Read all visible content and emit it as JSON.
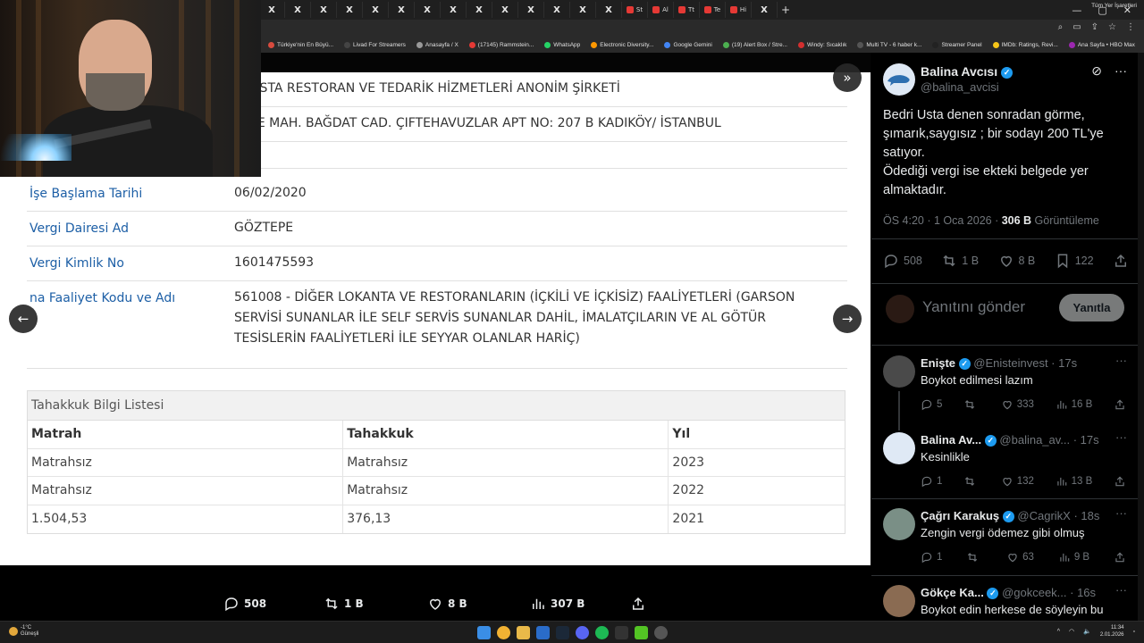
{
  "browser": {
    "tabs": [
      {
        "icon": "x-logo",
        "label": "X"
      },
      {
        "icon": "x-logo",
        "label": "X"
      },
      {
        "icon": "x-logo",
        "label": "X"
      },
      {
        "icon": "x-logo",
        "label": "X"
      },
      {
        "icon": "x-logo",
        "label": "X"
      },
      {
        "icon": "x-logo",
        "label": "X"
      },
      {
        "icon": "x-logo",
        "label": "X"
      },
      {
        "icon": "x-logo",
        "label": "X"
      },
      {
        "icon": "x-logo",
        "label": "X"
      },
      {
        "icon": "x-logo",
        "label": "X"
      },
      {
        "icon": "x-logo",
        "label": "X"
      },
      {
        "icon": "x-logo",
        "label": "X"
      },
      {
        "icon": "x-logo",
        "label": "X"
      },
      {
        "icon": "x-logo",
        "label": "X"
      },
      {
        "icon": "x-logo",
        "label": "X"
      },
      {
        "icon": "x-logo",
        "label": "X"
      },
      {
        "icon": "x-logo",
        "label": "X"
      },
      {
        "icon": "x-logo",
        "label": "X"
      },
      {
        "icon": "x-logo",
        "label": "X"
      },
      {
        "icon": "x-logo",
        "label": "X"
      },
      {
        "icon": "x-logo",
        "label": "X"
      },
      {
        "icon": "x-logo",
        "label": "X"
      },
      {
        "icon": "x-logo",
        "label": "X"
      },
      {
        "icon": "x-logo",
        "label": "X"
      },
      {
        "icon": "red-logo",
        "label": "St"
      },
      {
        "icon": "red-logo",
        "label": "Al"
      },
      {
        "icon": "red-logo",
        "label": "Tt"
      },
      {
        "icon": "red-logo",
        "label": "Te"
      },
      {
        "icon": "red-logo",
        "label": "Hi"
      },
      {
        "icon": "x-logo",
        "label": "X"
      }
    ],
    "new_tab": "+",
    "bookmarks": [
      "Türkiye'nin En Büyü...",
      "Livad For Streamers",
      "Anasayfa / X",
      "(17145) Rammstein...",
      "WhatsApp",
      "Electronic Diversity...",
      "Google Gemini",
      "(19) Alert Box / Stre...",
      "Windy: Sıcaklık",
      "Multi TV - 6 haber k...",
      "Streamer Panel",
      "IMDb: Ratings, Revi...",
      "Ana Sayfa • HBO Max"
    ],
    "bookmarks_all": "Tüm Yer İşaretleri"
  },
  "document": {
    "rows": [
      {
        "label": "",
        "value": "Rİ USTA RESTORAN VE TEDARİK HİZMETLERİ ANONİM ŞİRKETİ"
      },
      {
        "label": "",
        "value": "TEPE MAH. BAĞDAT CAD. ÇIFTEHAVUZLAR APT NO: 207 B KADIKÖY/ İSTANBUL"
      },
      {
        "label": "Faal",
        "value": "Faal"
      },
      {
        "label": "İşe Başlama Tarihi",
        "value": "06/02/2020"
      },
      {
        "label": "Vergi Dairesi Ad",
        "value": "GÖZTEPE"
      },
      {
        "label": "Vergi Kimlik No",
        "value": "1601475593"
      },
      {
        "label": "na Faaliyet Kodu ve Adı",
        "value": "561008 - DİĞER LOKANTA VE RESTORANLARIN (İÇKİLİ VE İÇKİSİZ) FAALİYETLERİ (GARSON SERVİSİ SUNANLAR İLE SELF SERVİS SUNANLAR DAHİL, İMALATÇILARIN VE AL GÖTÜR TESİSLERİN FAALİYETLERİ İLE SEYYAR OLANLAR HARİÇ)"
      }
    ],
    "tahakkuk": {
      "title": "Tahakkuk Bilgi Listesi",
      "columns": [
        "Matrah",
        "Tahakkuk",
        "Yıl"
      ],
      "rows": [
        [
          "Matrahsız",
          "Matrahsız",
          "2023"
        ],
        [
          "Matrahsız",
          "Matrahsız",
          "2022"
        ],
        [
          "1.504,53",
          "376,13",
          "2021"
        ]
      ]
    }
  },
  "viewer_actions": {
    "replies": "508",
    "reposts": "1 B",
    "likes": "8 B",
    "views": "307 B"
  },
  "post": {
    "author_name": "Balina Avcısı",
    "author_handle": "@balina_avcisi",
    "text": "Bedri Usta denen sonradan görme,\nşımarık,saygısız ; bir sodayı 200 TL'ye\nsatıyor.\nÖdediği vergi ise ekteki belgede yer\nalmaktadır.",
    "time": "ÖS 4:20 · 1 Oca 2026 · ",
    "views_count": "306 B",
    "views_label": " Görüntüleme",
    "actions": {
      "replies": "508",
      "reposts": "1 B",
      "likes": "8 B",
      "bookmarks": "122"
    },
    "reply_placeholder": "Yanıtını gönder",
    "reply_button": "Yanıtla"
  },
  "replies": [
    {
      "name": "Enişte",
      "handle": "@Enisteinvest · 17s",
      "text": "Boykot edilmesi lazım",
      "replies": "5",
      "reposts": "",
      "likes": "333",
      "views": "16 B",
      "avatar_color": "#4a4a4a"
    },
    {
      "name": "Balina Av...",
      "handle": "@balina_av... · 17s",
      "text": "Kesinlikle",
      "replies": "1",
      "reposts": "",
      "likes": "132",
      "views": "13 B",
      "avatar_color": "#dfe9f5"
    },
    {
      "name": "Çağrı Karakuş",
      "handle": "@CagrikX · 18s",
      "text": "Zengin vergi ödemez gibi olmuş",
      "replies": "1",
      "reposts": "",
      "likes": "63",
      "views": "9 B",
      "avatar_color": "#7a8f86"
    },
    {
      "name": "Gökçe Ka...",
      "handle": "@gokceek... · 16s",
      "text": "Boykot edin herkese de söyleyin bu",
      "replies": "",
      "reposts": "",
      "likes": "",
      "views": "",
      "avatar_color": "#8a6b52"
    }
  ],
  "taskbar": {
    "weather_temp": "-1°C",
    "weather_desc": "Güneşli",
    "time": "11:34",
    "date": "2.01.2026"
  }
}
